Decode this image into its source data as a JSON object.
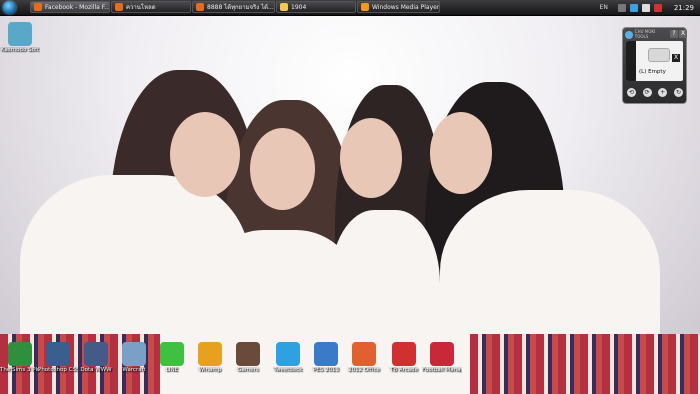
{
  "taskbar": {
    "tasks": [
      {
        "label": "Facebook - Mozilla F...",
        "color": "#e86a1c",
        "active": true
      },
      {
        "label": "ควานโหลด",
        "color": "#e86a1c",
        "active": false
      },
      {
        "label": "8888 ได้ทุกยามจริง ได้...",
        "color": "#e86a1c",
        "active": false
      },
      {
        "label": "1904",
        "color": "#f2c94c",
        "active": false
      },
      {
        "label": "Windows Media Player",
        "color": "#f29a1c",
        "active": false
      }
    ],
    "tray": {
      "lang": "EN",
      "time": "21:29"
    }
  },
  "desktop": {
    "top_icon": {
      "label": "Kasmodo Soft",
      "color": "#5aa8c8"
    },
    "bottom_icons": [
      {
        "label": "The Sims 3 Plus",
        "color": "#2f8f3f"
      },
      {
        "label": "Photoshop CS5",
        "color": "#3a5f8f"
      },
      {
        "label": "Dota WWW",
        "color": "#445a88"
      },
      {
        "label": "Warcraft",
        "color": "#7aa0c8"
      },
      {
        "label": "LINE",
        "color": "#40c040"
      },
      {
        "label": "Winamp",
        "color": "#e8a020"
      },
      {
        "label": "Gamers",
        "color": "#6a4a3a"
      },
      {
        "label": "Tweetdeck",
        "color": "#2fa0e0"
      },
      {
        "label": "PES 2013",
        "color": "#3a7ac8"
      },
      {
        "label": "2012 Office",
        "color": "#e06030"
      },
      {
        "label": "TB Arcade",
        "color": "#d03030"
      },
      {
        "label": "Football Manager",
        "color": "#c82838"
      }
    ]
  },
  "gadget": {
    "title": "CHU MOKI TOOLS",
    "help": "?",
    "close": "X",
    "clear": "X",
    "status": "(L) Empty",
    "controls": [
      "⟲",
      "⟳",
      "+",
      "↻"
    ]
  }
}
